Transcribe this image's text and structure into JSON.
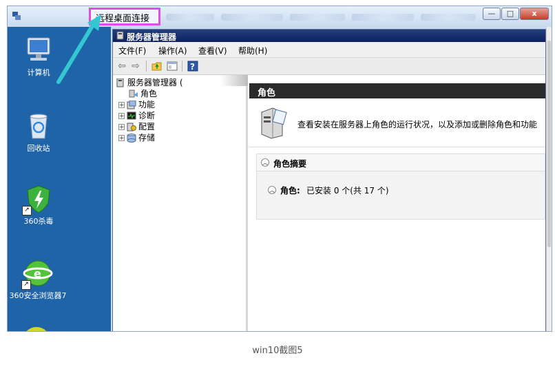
{
  "rdp": {
    "title": "远程桌面连接",
    "buttons": {
      "minimize": "—",
      "maximize": "□",
      "close": "x"
    }
  },
  "desktop": {
    "icons": [
      {
        "label": "计算机",
        "icon": "computer-icon"
      },
      {
        "label": "回收站",
        "icon": "recycle-bin-icon"
      },
      {
        "label": "360杀毒",
        "icon": "360-antivirus-icon"
      },
      {
        "label": "360安全浏览器7",
        "icon": "360-browser-icon"
      }
    ]
  },
  "server_manager": {
    "title": "服务器管理器",
    "menu": [
      "文件(F)",
      "操作(A)",
      "查看(V)",
      "帮助(H)"
    ],
    "tree": {
      "root": "服务器管理器 (",
      "items": [
        "角色",
        "功能",
        "诊断",
        "配置",
        "存储"
      ]
    },
    "main": {
      "header": "角色",
      "info": "查看安装在服务器上角色的运行状况，以及添加或删除角色和功能",
      "summary_title": "角色摘要",
      "roles_label": "角色:",
      "roles_status": "已安装 0 个(共 17 个)"
    }
  },
  "caption": "win10截图5",
  "colors": {
    "highlight": "#e14be6",
    "arrow": "#33c7d1",
    "desktop": "#1f64a8",
    "titlebar": "#0b2160"
  }
}
